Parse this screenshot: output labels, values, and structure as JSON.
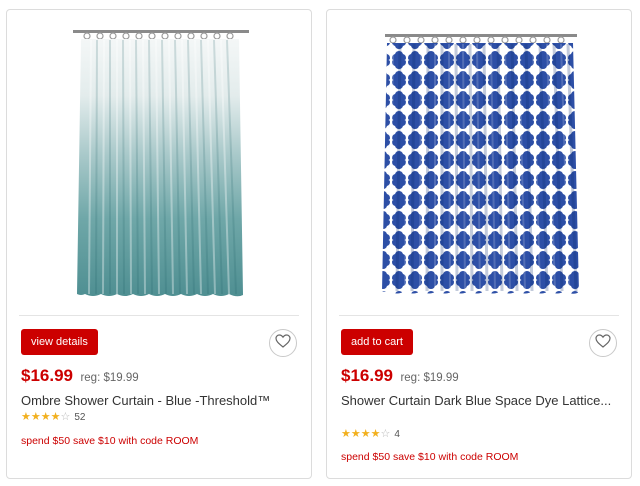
{
  "colors": {
    "accent": "#cc0000",
    "star": "#f2b01e"
  },
  "products": [
    {
      "action_label": "view details",
      "price": "$16.99",
      "reg_price": "reg: $19.99",
      "title": "Ombre Shower Curtain - Blue -Threshold™",
      "rating": 4,
      "rating_max": 5,
      "review_count": "52",
      "promo": "spend $50 save $10 with code ROOM",
      "image": "ombre-curtain-image"
    },
    {
      "action_label": "add to cart",
      "price": "$16.99",
      "reg_price": "reg: $19.99",
      "title": "Shower Curtain Dark Blue Space Dye Lattice...",
      "rating": 4,
      "rating_max": 5,
      "review_count": "4",
      "promo": "spend $50 save $10 with code ROOM",
      "image": "lattice-curtain-image"
    }
  ]
}
